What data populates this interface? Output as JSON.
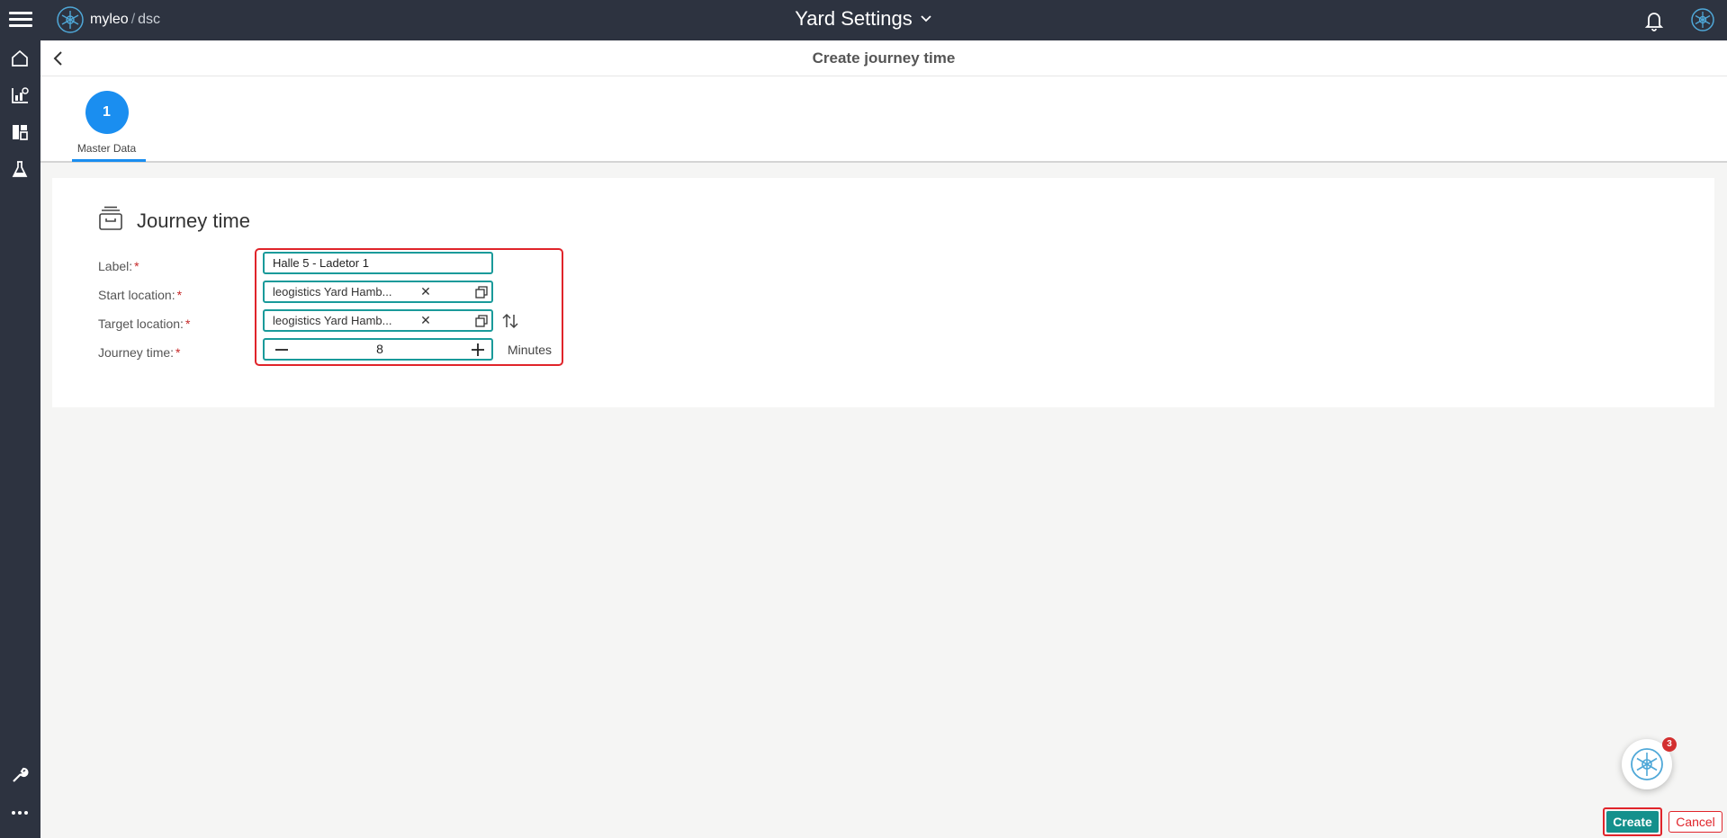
{
  "topbar": {
    "logo_name": "myleo",
    "logo_separator": "/",
    "logo_sub": "dsc",
    "app_title": "Yard Settings"
  },
  "sidebar": {
    "top_items": [
      "home-icon",
      "analytics-icon",
      "dashboard-icon",
      "lab-icon"
    ],
    "bottom_items": [
      "wrench-icon",
      "more-icon"
    ]
  },
  "header": {
    "title": "Create journey time"
  },
  "stepper": {
    "steps": [
      {
        "number": "1",
        "label": "Master Data"
      }
    ]
  },
  "form": {
    "section_title": "Journey time",
    "required_marker": "*",
    "label_label": "Label:",
    "label_value": "Halle 5 - Ladetor 1",
    "start_label": "Start location:",
    "start_value": "leogistics Yard Hamb...",
    "target_label": "Target location:",
    "target_value": "leogistics Yard Hamb...",
    "journey_label": "Journey time:",
    "journey_value": "8",
    "journey_unit": "Minutes"
  },
  "fab": {
    "badge_count": "3"
  },
  "actions": {
    "create_label": "Create",
    "cancel_label": "Cancel"
  },
  "colors": {
    "topbar": "#2d3340",
    "accent_blue": "#1a8ef0",
    "field_border": "#1a9a9a",
    "create_bg": "#14908c",
    "highlight": "#e0242a"
  }
}
